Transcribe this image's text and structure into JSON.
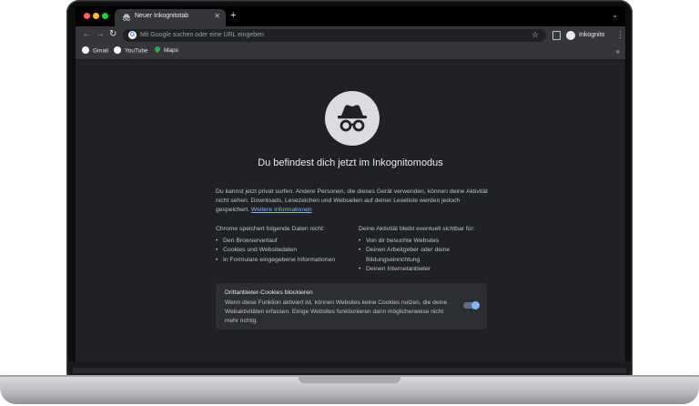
{
  "browser": {
    "tab_title": "Neuer Inkognitotab",
    "omnibox_placeholder": "Mit Google suchen oder eine URL eingeben",
    "profile_label": "Inkognito",
    "bookmarks": [
      "Gmail",
      "YouTube",
      "Maps"
    ],
    "window_colors": {
      "close": "#ff5f57",
      "minimize": "#febc2e",
      "maximize": "#28c840"
    }
  },
  "icons": {
    "tab": "incognito-icon",
    "close": "close-icon",
    "new_tab": "plus-icon",
    "back": "back-arrow-icon",
    "forward": "forward-arrow-icon",
    "reload": "reload-icon",
    "bookmark": "star-icon",
    "side_panel": "side-panel-icon",
    "menu": "kebab-menu-icon",
    "more_bookmarks": "chevron-double-right-icon",
    "hero": "incognito-icon"
  },
  "page": {
    "heading": "Du befindest dich jetzt im Inkognitomodus",
    "intro_text": "Du kannst jetzt privat surfen. Andere Personen, die dieses Gerät verwenden, können deine Aktivität nicht sehen. Downloads, Lesezeichen und Webseiten auf deiner Leseliste werden jedoch gespeichert.",
    "learn_more": "Weitere Informationen",
    "left_title": "Chrome speichert folgende Daten nicht:",
    "left_items": [
      "Den Browserverlauf",
      "Cookies und Websitedaten",
      "In Formulare eingegebene Informationen"
    ],
    "right_title": "Deine Aktivität bleibt eventuell sichtbar für:",
    "right_items": [
      "Von dir besuchte Websites",
      "Deinen Arbeitgeber oder deine Bildungseinrichtung",
      "Deinen Internetanbieter"
    ],
    "cookie_title": "Drittanbieter-Cookies blockieren",
    "cookie_desc": "Wenn diese Funktion aktiviert ist, können Websites keine Cookies nutzen, die deine Webaktivitäten erfassen. Einige Websites funktionieren dann möglicherweise nicht mehr richtig.",
    "cookie_toggle_on": true
  },
  "colors": {
    "accent": "#8ab4f8",
    "background": "#202124"
  }
}
